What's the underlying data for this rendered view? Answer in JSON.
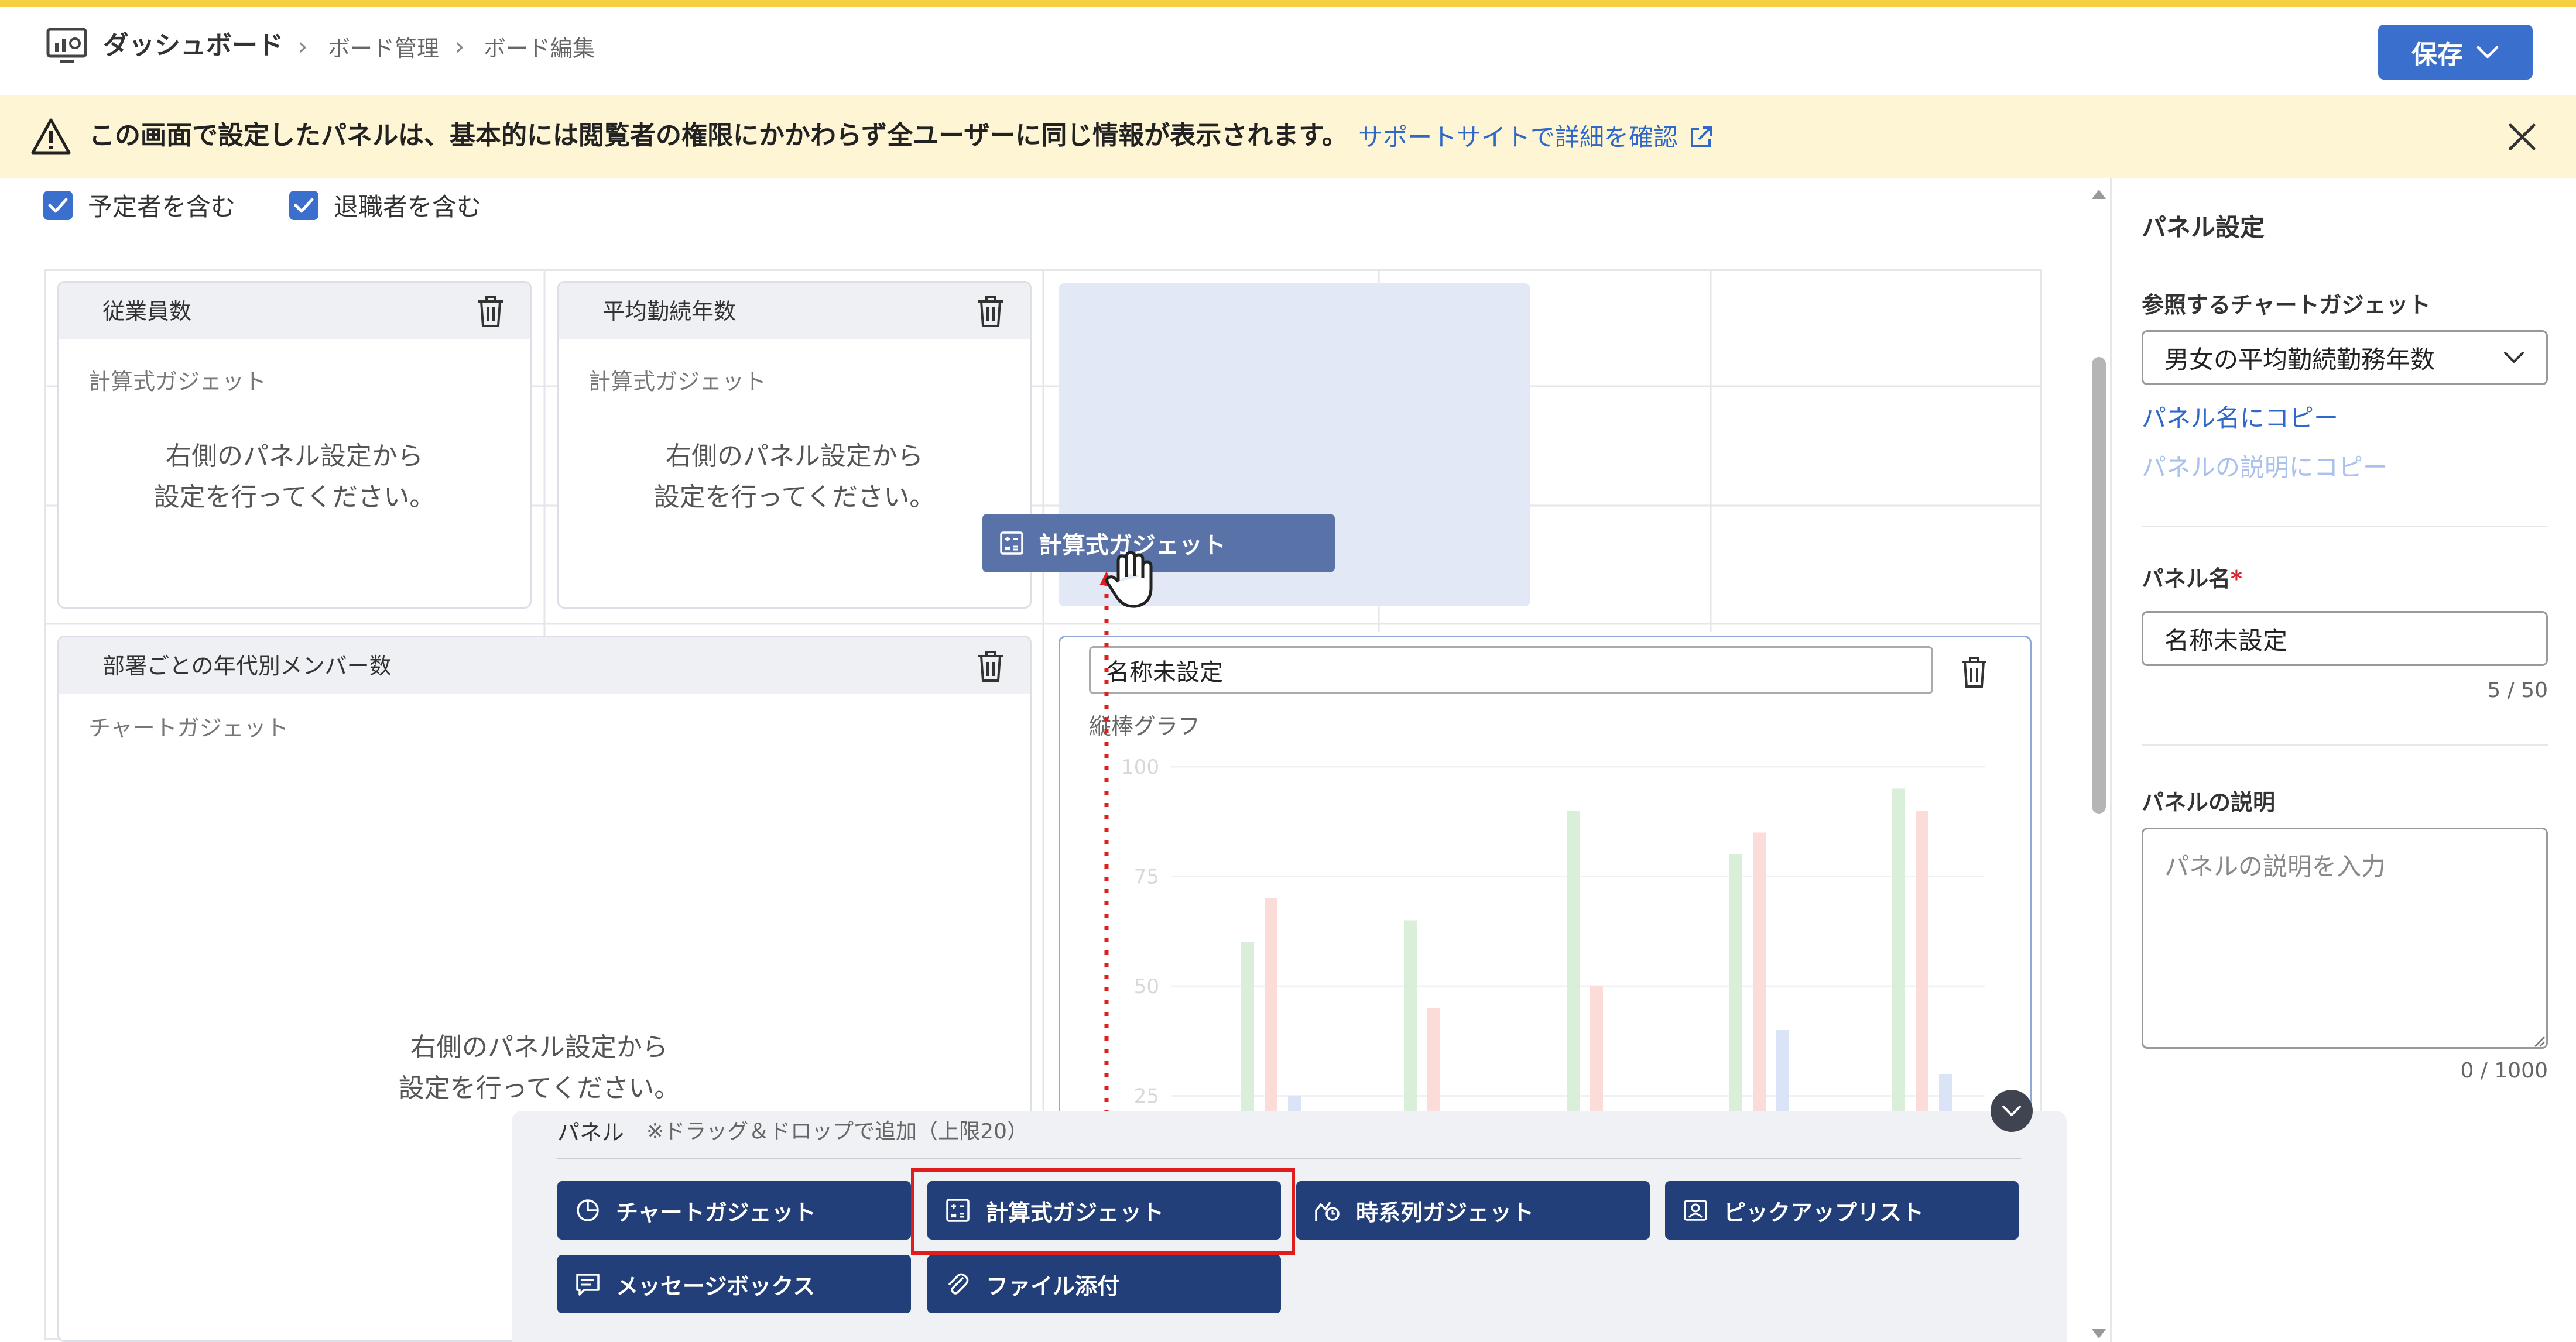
{
  "header": {
    "app_title": "ダッシュボード",
    "breadcrumbs": [
      "ボード管理",
      "ボード編集"
    ],
    "save_label": "保存"
  },
  "banner": {
    "message": "この画面で設定したパネルは、基本的には閲覧者の権限にかかわらず全ユーザーに同じ情報が表示されます。",
    "link_label": "サポートサイトで詳細を確認"
  },
  "filters": [
    {
      "label": "予定者を含む",
      "checked": true
    },
    {
      "label": "退職者を含む",
      "checked": true
    }
  ],
  "panels": {
    "employees": {
      "title": "従業員数",
      "type": "計算式ガジェット",
      "hint_line1": "右側のパネル設定から",
      "hint_line2": "設定を行ってください。"
    },
    "tenure": {
      "title": "平均勤続年数",
      "type": "計算式ガジェット",
      "hint_line1": "右側のパネル設定から",
      "hint_line2": "設定を行ってください。"
    },
    "dept_age": {
      "title": "部署ごとの年代別メンバー数",
      "type": "チャートガジェット",
      "hint_line1": "右側のパネル設定から",
      "hint_line2": "設定を行ってください。"
    },
    "editing": {
      "name_value": "名称未設定",
      "chart_type": "縦棒グラフ"
    }
  },
  "drag_ghost": {
    "label": "計算式ガジェット"
  },
  "chart_data": {
    "type": "bar",
    "yticks": [
      100,
      75,
      50,
      25
    ],
    "ylim": [
      0,
      100
    ],
    "series": [
      {
        "color": "#d9efd9",
        "values": [
          60,
          65,
          90,
          80,
          95
        ]
      },
      {
        "color": "#fbdcd8",
        "values": [
          70,
          45,
          50,
          85,
          90
        ]
      },
      {
        "color": "#dbe4f7",
        "values": [
          25,
          0,
          0,
          40,
          30
        ]
      }
    ]
  },
  "tray": {
    "title": "パネル",
    "note": "※ドラッグ＆ドロップで追加（上限20）",
    "gadgets": [
      {
        "label": "チャートガジェット",
        "icon": "pie-chart-icon"
      },
      {
        "label": "計算式ガジェット",
        "icon": "calculator-icon"
      },
      {
        "label": "時系列ガジェット",
        "icon": "time-series-icon"
      },
      {
        "label": "ピックアップリスト",
        "icon": "person-card-icon"
      },
      {
        "label": "メッセージボックス",
        "icon": "message-icon"
      },
      {
        "label": "ファイル添付",
        "icon": "paperclip-icon"
      }
    ]
  },
  "sidebar": {
    "title": "パネル設定",
    "ref_label": "参照するチャートガジェット",
    "ref_value": "男女の平均勤続勤務年数",
    "copy_name": "パネル名にコピー",
    "copy_desc": "パネルの説明にコピー",
    "name_label": "パネル名",
    "required_mark": "*",
    "name_value": "名称未設定",
    "name_count": "5 / 50",
    "desc_label": "パネルの説明",
    "desc_placeholder": "パネルの説明を入力",
    "desc_count": "0 / 1000"
  },
  "colors": {
    "primary": "#3a6fce",
    "gadget_button": "#233f7a",
    "banner_bg": "#fdf5d3",
    "highlight": "#e01c1c",
    "link": "#2f68c8"
  }
}
